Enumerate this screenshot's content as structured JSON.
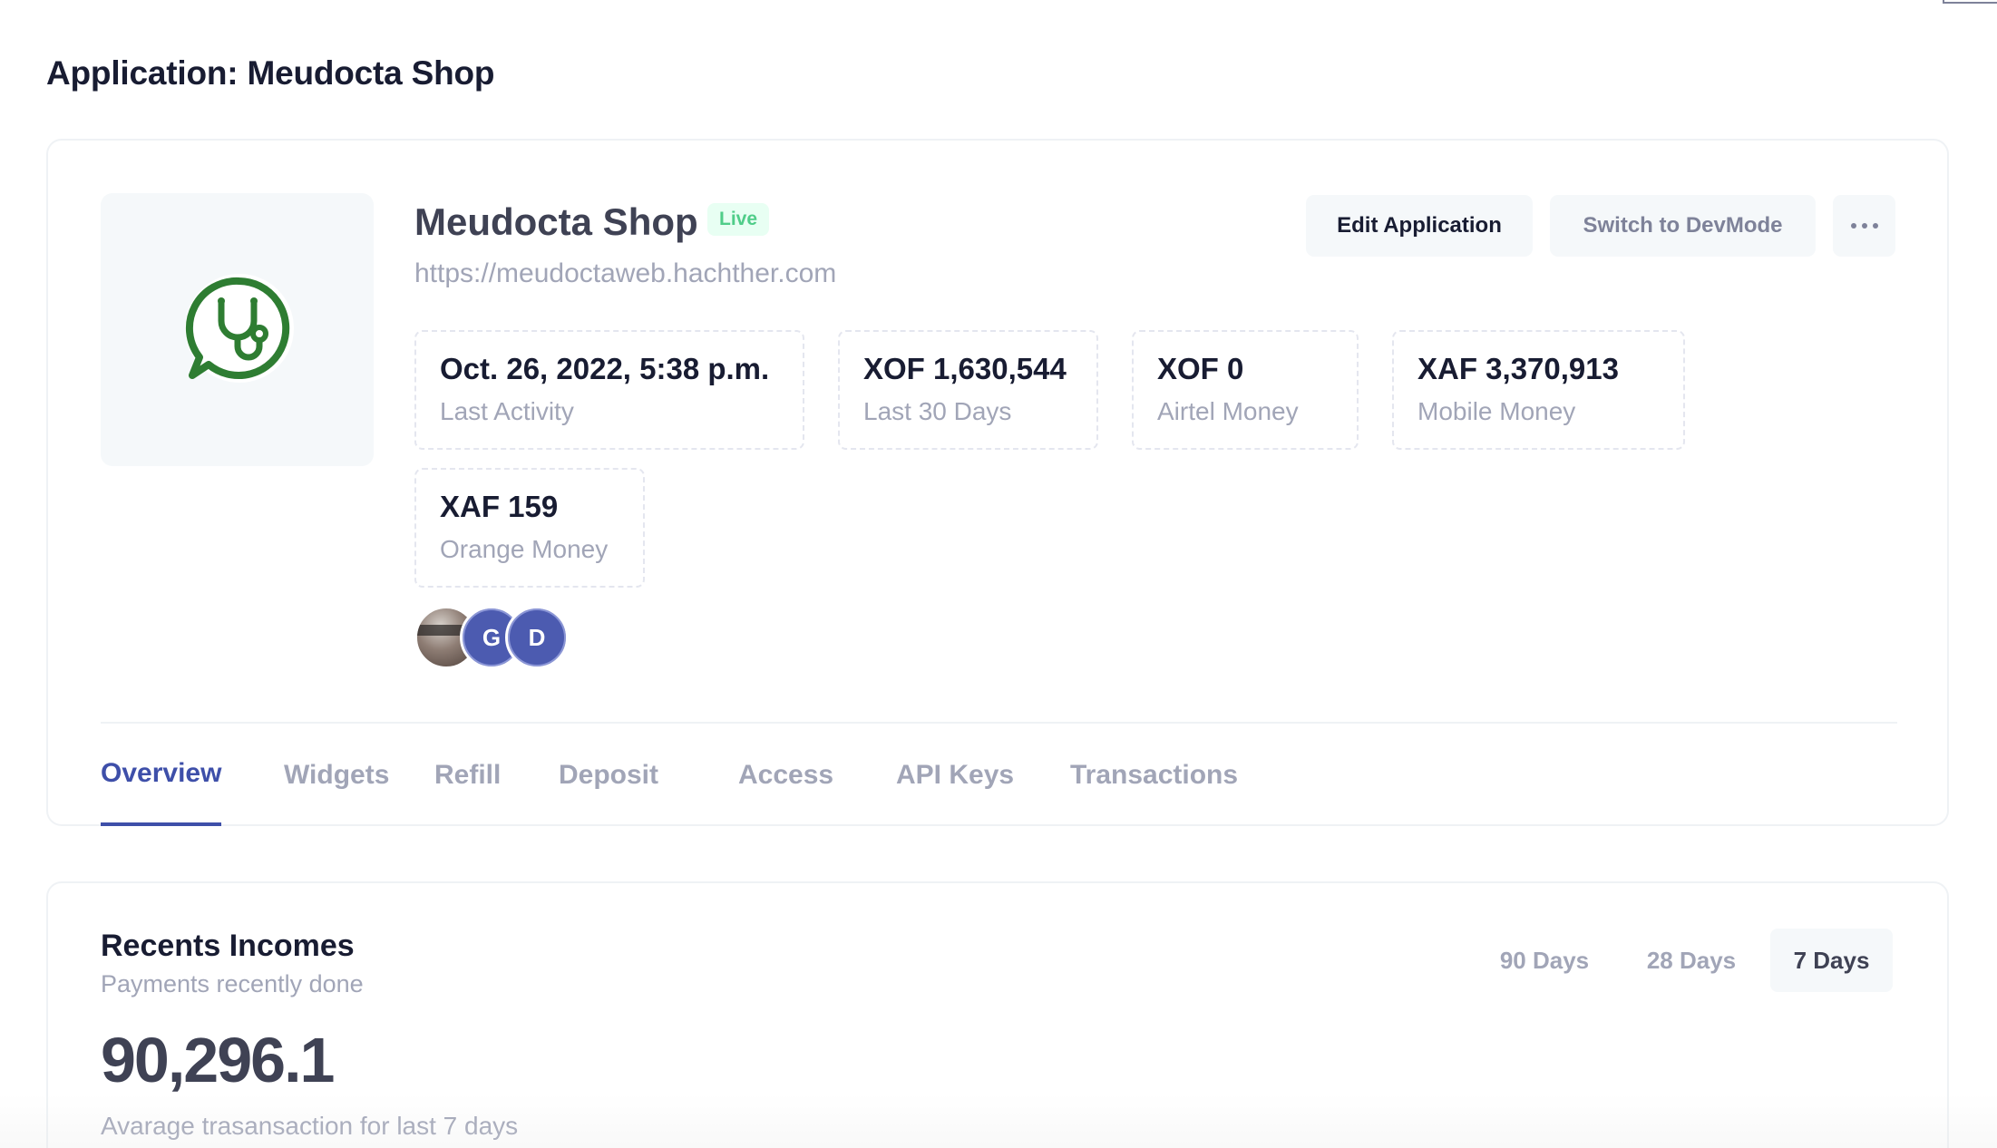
{
  "page": {
    "title": "Application: Meudocta Shop"
  },
  "app": {
    "name": "Meudocta Shop",
    "status": "Live",
    "url": "https://meudoctaweb.hachther.com",
    "logo_icon": "stethoscope-chat-icon",
    "accent_color": "#2e7d32"
  },
  "actions": {
    "edit_label": "Edit Application",
    "devmode_label": "Switch to DevMode",
    "more_icon": "more-horizontal-icon"
  },
  "stats": [
    {
      "value": "Oct. 26, 2022, 5:38 p.m.",
      "label": "Last Activity"
    },
    {
      "value": "XOF 1,630,544",
      "label": "Last 30 Days"
    },
    {
      "value": "XOF 0",
      "label": "Airtel Money"
    },
    {
      "value": "XAF 3,370,913",
      "label": "Mobile Money"
    },
    {
      "value": "XAF 159",
      "label": "Orange Money"
    }
  ],
  "members": [
    {
      "type": "photo"
    },
    {
      "initial": "G"
    },
    {
      "initial": "D"
    }
  ],
  "tabs": [
    {
      "label": "Overview",
      "active": true
    },
    {
      "label": "Widgets"
    },
    {
      "label": "Refill"
    },
    {
      "label": "Deposit"
    },
    {
      "label": "Access"
    },
    {
      "label": "API Keys"
    },
    {
      "label": "Transactions"
    }
  ],
  "incomes": {
    "title": "Recents Incomes",
    "subtitle": "Payments recently done",
    "ranges": [
      {
        "label": "90 Days"
      },
      {
        "label": "28 Days"
      },
      {
        "label": "7 Days",
        "active": true
      }
    ],
    "value": "90,296.1",
    "caption": "Avarage trasansaction for last 7 days"
  },
  "colors": {
    "primary": "#3e4fa9",
    "live_text": "#50cd89",
    "live_bg": "#e8fff3",
    "muted": "#a1a5b7"
  }
}
